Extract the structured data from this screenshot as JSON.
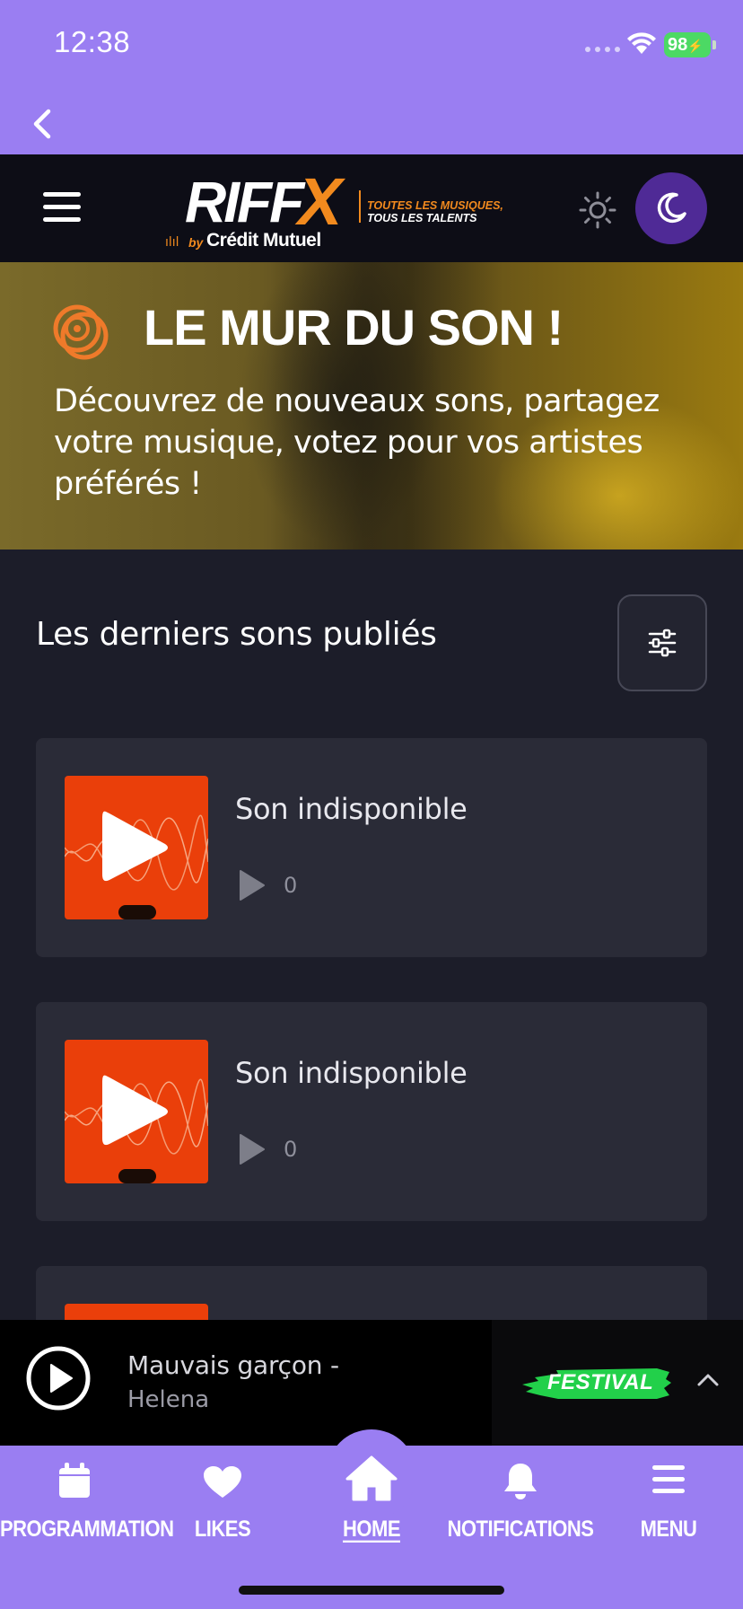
{
  "status": {
    "time": "12:38",
    "battery": "98"
  },
  "header": {
    "logo_main": "RIFF",
    "logo_x": "X",
    "tagline_1": "TOUTES LES MUSIQUES,",
    "tagline_2": "TOUS LES TALENTS",
    "logo_by": "by",
    "logo_sponsor": "Crédit Mutuel"
  },
  "hero": {
    "title": "LE MUR DU SON !",
    "text": "Découvrez de nouveaux sons, partagez votre musique, votez pour vos artistes préférés !"
  },
  "section": {
    "title": "Les derniers sons publiés"
  },
  "tracks": [
    {
      "title": "Son indisponible",
      "plays": "0"
    },
    {
      "title": "Son indisponible",
      "plays": "0"
    }
  ],
  "player": {
    "title": "Mauvais garçon -",
    "artist": "Helena",
    "badge": "FESTIVAL"
  },
  "tabs": [
    {
      "label": "PROGRAMMATION",
      "icon": "calendar-icon"
    },
    {
      "label": "LIKES",
      "icon": "heart-icon"
    },
    {
      "label": "HOME",
      "icon": "home-icon",
      "active": true
    },
    {
      "label": "NOTIFICATIONS",
      "icon": "bell-icon"
    },
    {
      "label": "MENU",
      "icon": "menu-icon"
    }
  ],
  "colors": {
    "accent_purple": "#9a7ef2",
    "brand_orange": "#f28a1e",
    "thumb_red": "#ea3f0a",
    "festival_green": "#22d04a",
    "dark_bg": "#1c1d29"
  }
}
